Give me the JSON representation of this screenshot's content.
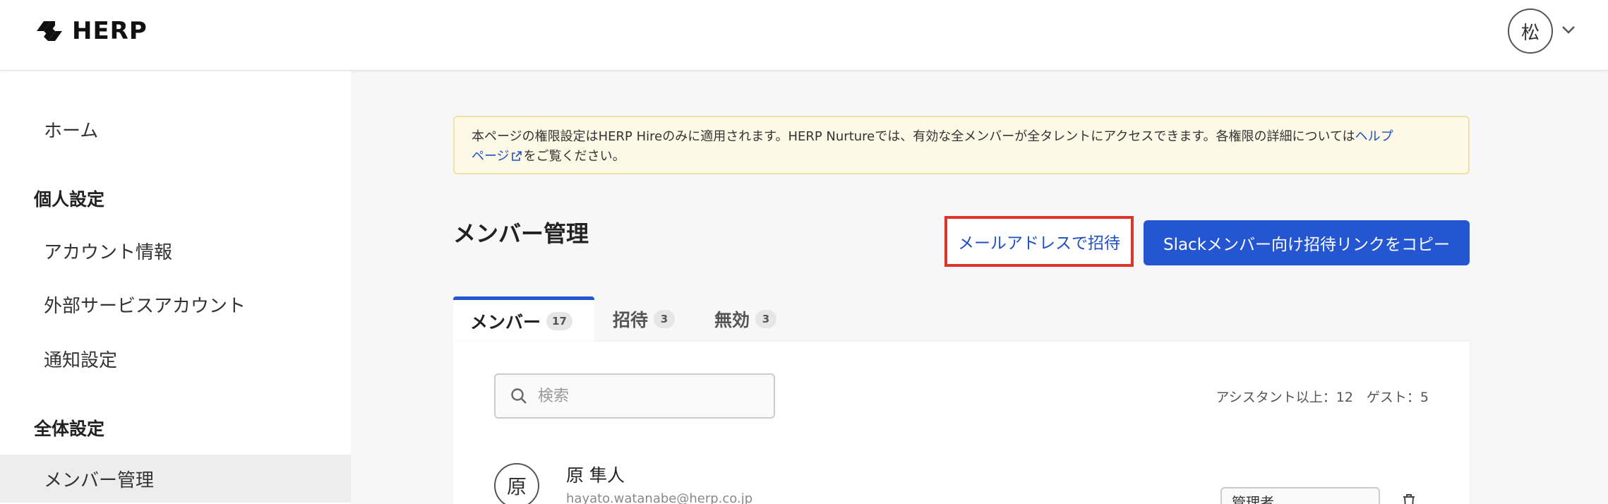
{
  "header": {
    "logo_text": "HERP",
    "user_avatar_char": "松"
  },
  "sidebar": {
    "home": "ホーム",
    "personal_section": "個人設定",
    "account_info": "アカウント情報",
    "external_accounts": "外部サービスアカウント",
    "notifications": "通知設定",
    "global_section": "全体設定",
    "member_management": "メンバー管理"
  },
  "notice": {
    "text_before": "本ページの権限設定はHERP Hireのみに適用されます。HERP Nurtureでは、有効な全メンバーが全タレントにアクセスできます。各権限の詳細については",
    "link_part1": "ヘルプ",
    "link_part2": "ページ",
    "text_after": "をご覧ください。"
  },
  "main": {
    "title": "メンバー管理",
    "invite_by_email": "メールアドレスで招待",
    "copy_slack_link": "Slackメンバー向け招待リンクをコピー"
  },
  "tabs": [
    {
      "label": "メンバー",
      "count": "17"
    },
    {
      "label": "招待",
      "count": "3"
    },
    {
      "label": "無効",
      "count": "3"
    }
  ],
  "search": {
    "placeholder": "検索"
  },
  "counts": {
    "text": "アシスタント以上：12　ゲスト：5"
  },
  "members": [
    {
      "initial": "原",
      "name": "原 隼人",
      "email": "hayato.watanabe@herp.co.jp",
      "role": "管理者"
    }
  ],
  "colors": {
    "primary": "#2456d1",
    "highlight_border": "#e0342a",
    "notice_bg": "#fdf9e6",
    "notice_border": "#efe2a6"
  }
}
